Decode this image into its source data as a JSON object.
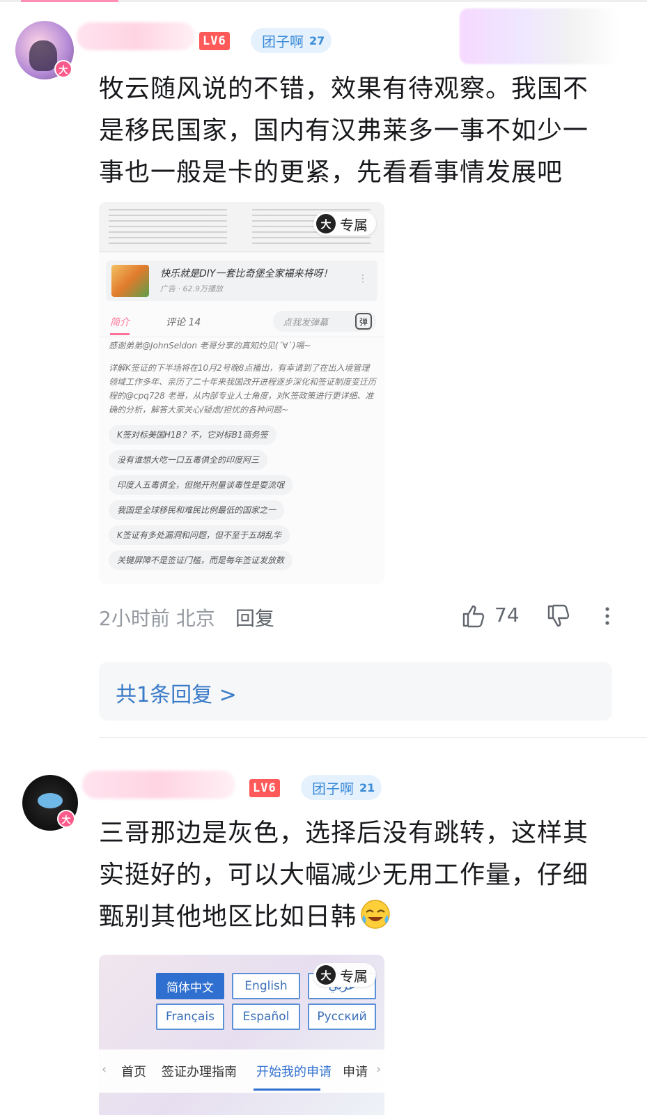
{
  "comment1": {
    "level_badge": "LV6",
    "fan_medal": {
      "name": "团子啊",
      "level": "27"
    },
    "avatar_badge": "大",
    "text": "牧云随风说的不错，效果有待观察。我国不是移民国家，国内有汉弗莱多一事不如少一事也一般是卡的更紧，先看看事情发展吧",
    "image": {
      "exclusive_badge": {
        "icon": "大",
        "label": "专属"
      },
      "ad": {
        "title": "快乐就是DIY一套比奇堡全家福来将呀！",
        "sub": "广告 · 62.9万播放"
      },
      "tabs": {
        "intro": "简介",
        "comments": "评论 14"
      },
      "danmu_placeholder": "点我发弹幕",
      "danmu_icon": "弹",
      "desc_lines": [
        "感谢弟弟@JohnSeldon 老哥分享的真知灼见(´∀`)嗝~",
        "详解K签证的下半场将在10月2号晚8点播出，有幸请到了在出入境管理领域工作多年、亲历了二十年来我国改开进程逐步深化和签证制度变迁历程的@cpq728 老哥，从内部专业人士角度，对K签政策进行更详细、准确的分析，解答大家关心/疑虑/担忧的各种问题~"
      ],
      "tags": [
        "K签对标美国H1B？不，它对标B1商务签",
        "没有谁想大吃一口五毒俱全的印度阿三",
        "印度人五毒俱全，但抛开剂量谈毒性是耍流氓",
        "我国是全球移民和难民比例最低的国家之一",
        "K签证有多处漏洞和问题，但不至于五胡乱华",
        "关键屏障不是签证门槛，而是每年签证发放数"
      ]
    },
    "time": "2小时前 北京",
    "reply": "回复",
    "likes": "74",
    "replies_link": "共1条回复 >"
  },
  "comment2": {
    "level_badge": "LV6",
    "fan_medal": {
      "name": "团子啊",
      "level": "21"
    },
    "avatar_badge": "大",
    "text": "三哥那边是灰色，选择后没有跳转，这样其实挺好的，可以大幅减少无用工作量，仔细甄别其他地区比如日韩",
    "image": {
      "exclusive_badge": {
        "icon": "大",
        "label": "专属"
      },
      "languages": [
        "简体中文",
        "English",
        "عربي",
        "Français",
        "Español",
        "Русский"
      ],
      "nav": [
        "首页",
        "签证办理指南",
        "开始我的申请",
        "申请"
      ]
    }
  },
  "colors": {
    "pink": "#fb7299",
    "blue_link": "#3a7bc8",
    "level_red": "#ff5a5a"
  }
}
